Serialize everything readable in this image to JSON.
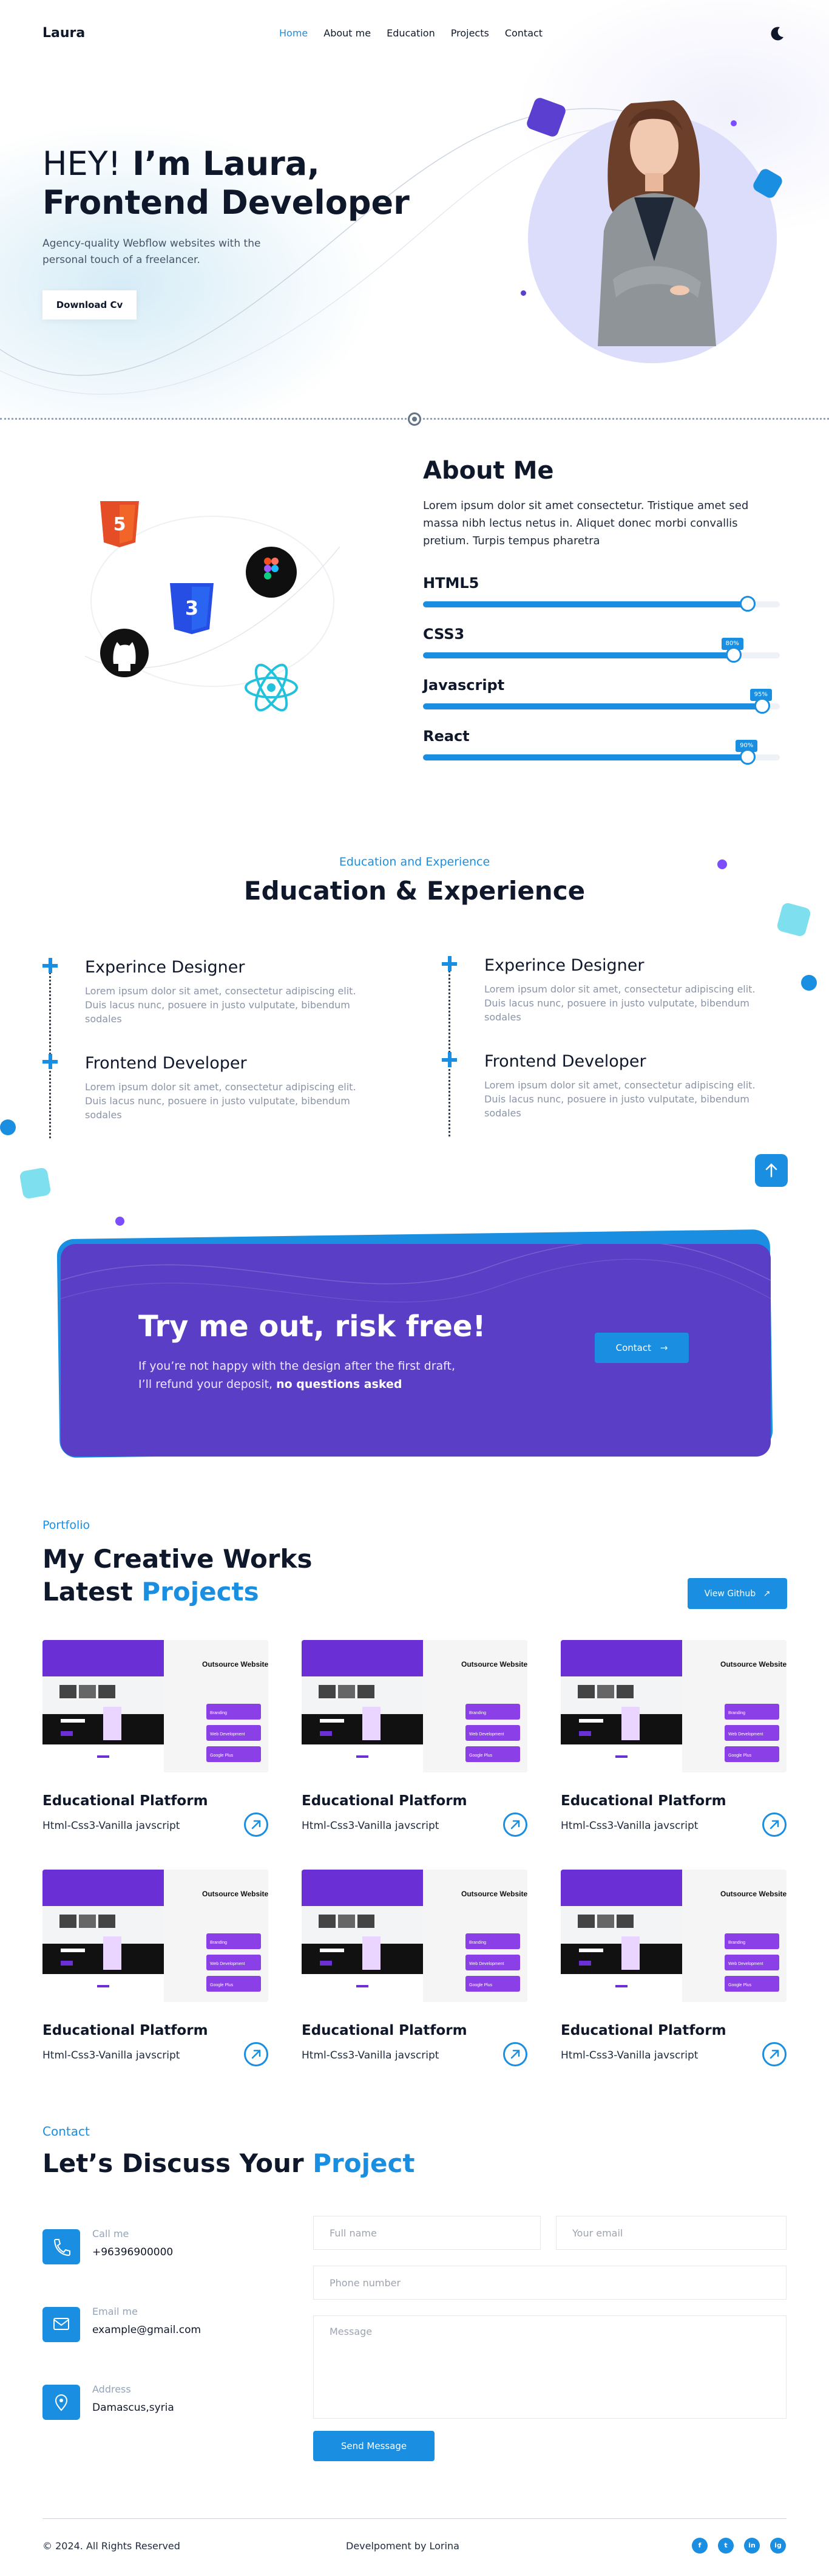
{
  "nav": {
    "logo": "Laura",
    "links": [
      "Home",
      "About me",
      "Education",
      "Projects",
      "Contact"
    ],
    "active": "Home"
  },
  "hero": {
    "greeting": "HEY!",
    "name_line": "I’m Laura,",
    "role": "Frontend Developer",
    "subtitle": "Agency-quality Webflow websites with the personal touch of a freelancer.",
    "cta_label": "Download Cv"
  },
  "about": {
    "title": "About Me",
    "text": "Lorem ipsum dolor sit amet consectetur. Tristique amet sed massa nibh lectus netus in. Aliquet donec morbi convallis pretium. Turpis tempus pharetra",
    "skills": [
      {
        "name": "HTML5",
        "percent": 91,
        "badge": ""
      },
      {
        "name": "CSS3",
        "percent": 87,
        "badge": "80%"
      },
      {
        "name": "Javascript",
        "percent": 95,
        "badge": "95%"
      },
      {
        "name": "React",
        "percent": 91,
        "badge": "90%"
      }
    ],
    "icons": [
      "html5-icon",
      "figma-icon",
      "css3-icon",
      "github-icon",
      "react-icon"
    ]
  },
  "education": {
    "kicker": "Education and Experience",
    "title": "Education & Experience",
    "left": [
      {
        "title": "Experince Designer",
        "text": "Lorem ipsum dolor sit amet, consectetur adipiscing elit. Duis lacus nunc, posuere in justo vulputate, bibendum sodales"
      },
      {
        "title": "Frontend Developer",
        "text": "Lorem ipsum dolor sit amet, consectetur adipiscing elit. Duis lacus nunc, posuere in justo vulputate, bibendum sodales"
      }
    ],
    "right": [
      {
        "title": "Experince Designer",
        "text": "Lorem ipsum dolor sit amet, consectetur adipiscing elit. Duis lacus nunc, posuere in justo vulputate, bibendum sodales"
      },
      {
        "title": "Frontend Developer",
        "text": "Lorem ipsum dolor sit amet, consectetur adipiscing elit. Duis lacus nunc, posuere in justo vulputate, bibendum sodales"
      }
    ]
  },
  "cta": {
    "title": "Try me out, risk free!",
    "line1": "If you’re not happy with the design after the first draft,",
    "line2_prefix": "I’ll refund your deposit, ",
    "line2_bold": "no questions asked",
    "button": "Contact"
  },
  "portfolio": {
    "kicker": "Portfolio",
    "title_line1": "My Creative Works",
    "title_line2_prefix": "Latest ",
    "title_line2_accent": "Projects",
    "github_button": "View Github",
    "preview_heading": "Outsource Website",
    "preview_tags": [
      "Branding",
      "Web Development",
      "Google Plus"
    ],
    "projects": [
      {
        "title": "Educational Platform",
        "tech": "Html-Css3-Vanilla javscript"
      },
      {
        "title": "Educational Platform",
        "tech": "Html-Css3-Vanilla javscript"
      },
      {
        "title": "Educational Platform",
        "tech": "Html-Css3-Vanilla javscript"
      },
      {
        "title": "Educational Platform",
        "tech": "Html-Css3-Vanilla javscript"
      },
      {
        "title": "Educational Platform",
        "tech": "Html-Css3-Vanilla javscript"
      },
      {
        "title": "Educational Platform",
        "tech": "Html-Css3-Vanilla javscript"
      }
    ]
  },
  "contact": {
    "kicker": "Contact",
    "title_prefix": "Let’s Discuss Your ",
    "title_accent": "Project",
    "items": [
      {
        "label": "Call me",
        "value": "+96396900000",
        "icon": "phone-icon"
      },
      {
        "label": "Email me",
        "value": "example@gmail.com",
        "icon": "mail-icon"
      },
      {
        "label": "Address",
        "value": "Damascus,syria",
        "icon": "location-icon"
      }
    ],
    "form": {
      "full_name_placeholder": "Full name",
      "email_placeholder": "Your email",
      "phone_placeholder": "Phone number",
      "message_placeholder": "Message",
      "send_button": "Send Message"
    }
  },
  "footer": {
    "copyright": "© 2024. All Rights Reserved",
    "credit": "Develpoment by Lorina",
    "social": [
      "f",
      "t",
      "in",
      "ig"
    ]
  },
  "colors": {
    "accent": "#1a8ee0",
    "purple": "#5a3fc6",
    "text": "#0f172a"
  }
}
